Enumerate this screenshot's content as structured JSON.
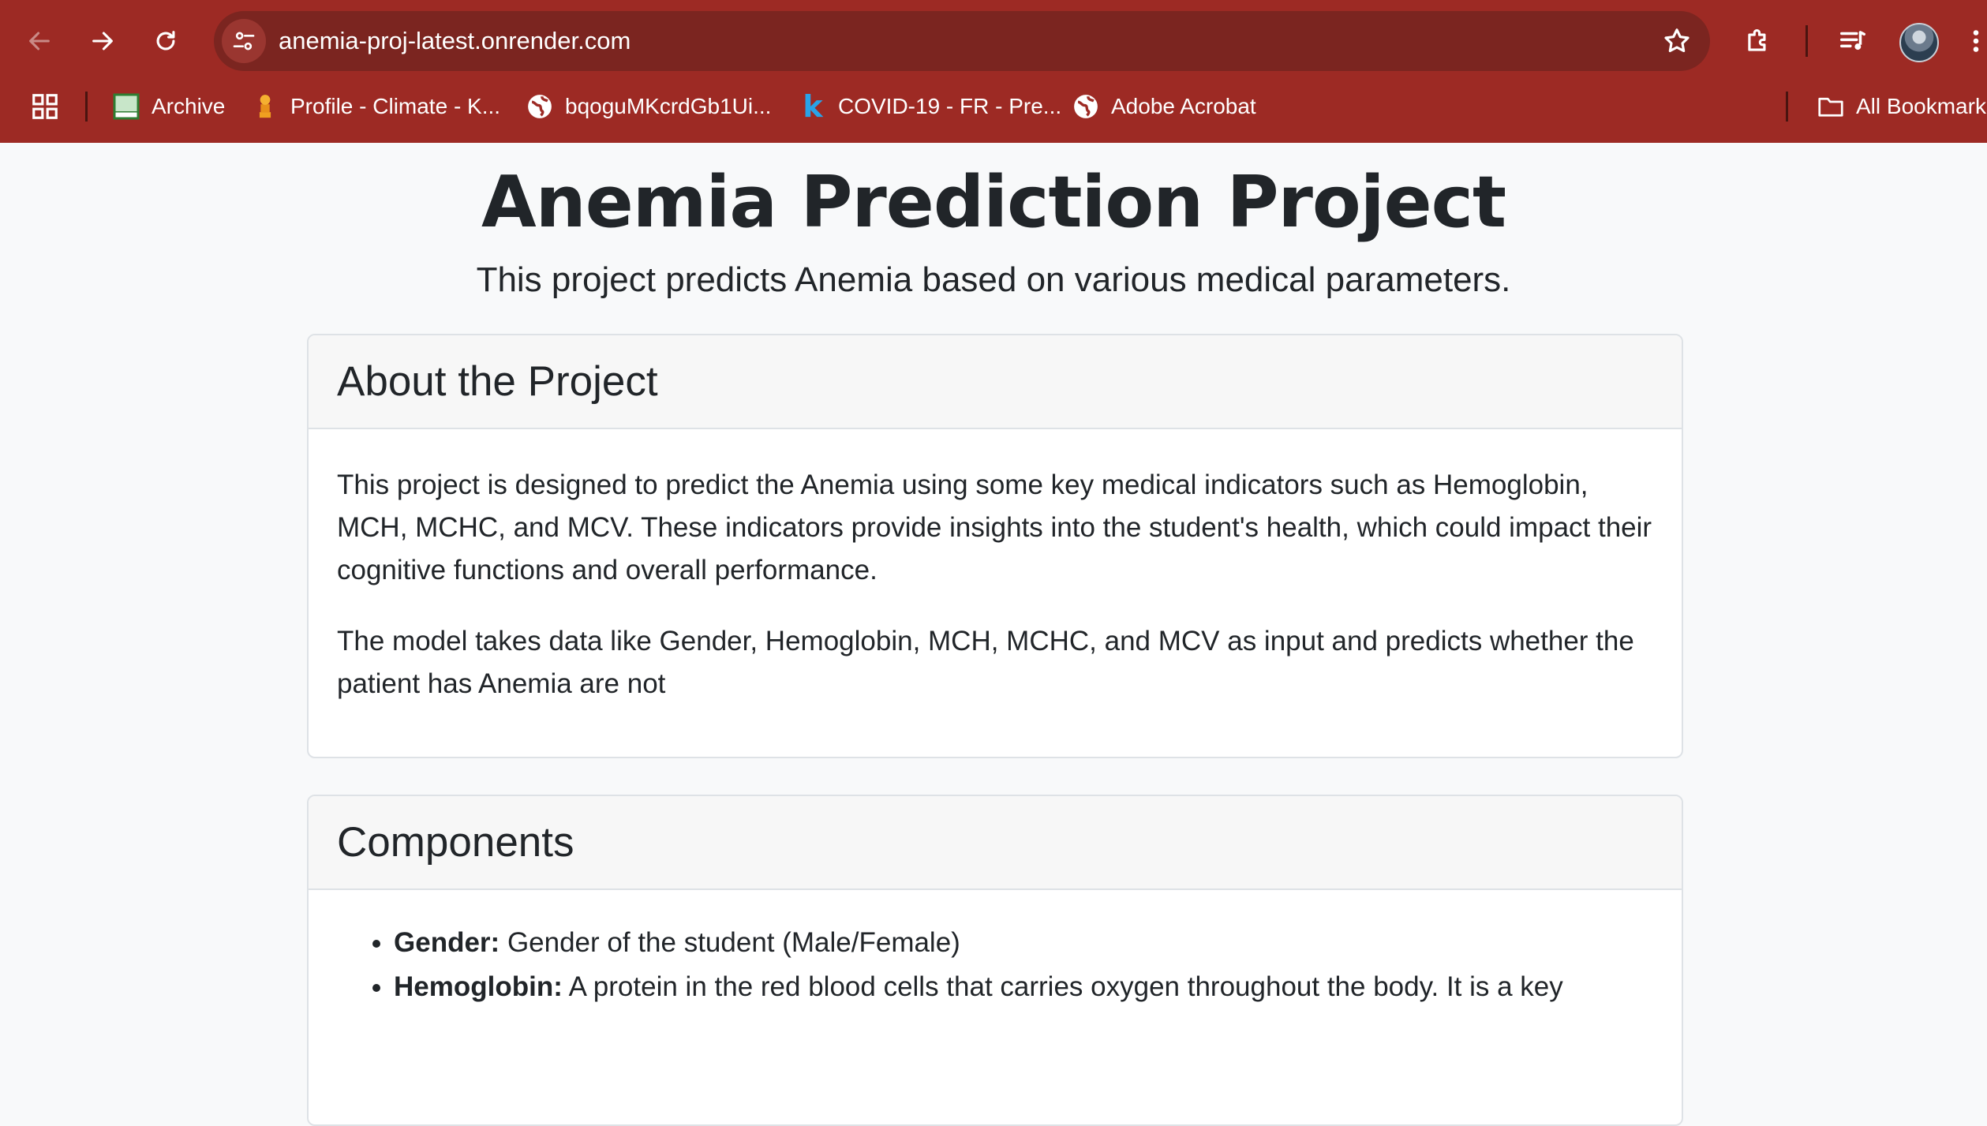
{
  "browser": {
    "url": "anemia-proj-latest.onrender.com",
    "bookmarks": [
      {
        "label": "Archive",
        "icon": "neeri-icon"
      },
      {
        "label": "Profile - Climate - K...",
        "icon": "emblem-icon"
      },
      {
        "label": "bqoguMKcrdGb1Ui...",
        "icon": "globe-icon"
      },
      {
        "label": "COVID-19 - FR - Pre...",
        "icon": "k-icon"
      },
      {
        "label": "Adobe Acrobat",
        "icon": "globe-icon"
      }
    ],
    "all_bookmarks_label": "All Bookmarks",
    "theme_color": "#9d2a24"
  },
  "page": {
    "title": "Anemia Prediction Project",
    "subtitle": "This project predicts Anemia based on various medical parameters.",
    "about": {
      "heading": "About the Project",
      "paragraphs": [
        "This project is designed to predict the Anemia using some key medical indicators such as Hemoglobin, MCH, MCHC, and MCV. These indicators provide insights into the student's health, which could impact their cognitive functions and overall performance.",
        "The model takes data like Gender, Hemoglobin, MCH, MCHC, and MCV as input and predicts whether the patient has Anemia are not"
      ]
    },
    "components": {
      "heading": "Components",
      "items": [
        {
          "term": "Gender:",
          "desc": "Gender of the student (Male/Female)"
        },
        {
          "term": "Hemoglobin:",
          "desc": "A protein in the red blood cells that carries oxygen throughout the body. It is a key"
        }
      ]
    }
  }
}
